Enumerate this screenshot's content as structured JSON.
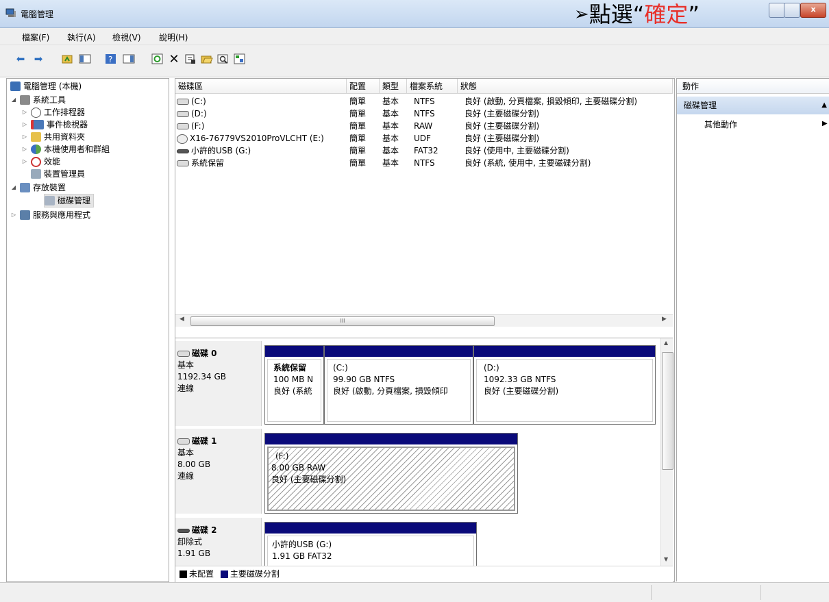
{
  "window": {
    "title": "電腦管理"
  },
  "annotation": {
    "arrow": "➢",
    "prefix": "點選“",
    "highlight": "確定",
    "suffix": "”"
  },
  "menu": [
    "檔案(F)",
    "執行(A)",
    "檢視(V)",
    "說明(H)"
  ],
  "tree": {
    "root": "電腦管理 (本機)",
    "system_tools": "系統工具",
    "task_scheduler": "工作排程器",
    "event_viewer": "事件檢視器",
    "shared_folders": "共用資料夾",
    "local_users": "本機使用者和群組",
    "performance": "效能",
    "device_manager": "裝置管理員",
    "storage": "存放裝置",
    "disk_management": "磁碟管理",
    "services": "服務與應用程式"
  },
  "columns": [
    "磁碟區",
    "配置",
    "類型",
    "檔案系統",
    "狀態"
  ],
  "volumes": [
    {
      "name": "(C:)",
      "layout": "簡單",
      "type": "基本",
      "fs": "NTFS",
      "status": "良好 (啟動, 分頁檔案, 損毀傾印, 主要磁碟分割)"
    },
    {
      "name": "(D:)",
      "layout": "簡單",
      "type": "基本",
      "fs": "NTFS",
      "status": "良好 (主要磁碟分割)"
    },
    {
      "name": "(F:)",
      "layout": "簡單",
      "type": "基本",
      "fs": "RAW",
      "status": "良好 (主要磁碟分割)"
    },
    {
      "name": "X16-76779VS2010ProVLCHT (E:)",
      "layout": "簡單",
      "type": "基本",
      "fs": "UDF",
      "status": "良好 (主要磁碟分割)"
    },
    {
      "name": "小許的USB (G:)",
      "layout": "簡單",
      "type": "基本",
      "fs": "FAT32",
      "status": "良好 (使用中, 主要磁碟分割)"
    },
    {
      "name": "系統保留",
      "layout": "簡單",
      "type": "基本",
      "fs": "NTFS",
      "status": "良好 (系統, 使用中, 主要磁碟分割)"
    }
  ],
  "hscroll_glyph": "III",
  "disks": [
    {
      "label": "磁碟 0",
      "kind": "基本",
      "size": "1192.34 GB",
      "state": "連線",
      "partitions": [
        {
          "line1": "系統保留",
          "line2": "100 MB N",
          "line3": "良好 (系統"
        },
        {
          "line1": "(C:)",
          "line2": "99.90 GB NTFS",
          "line3": "良好 (啟動, 分頁檔案, 損毀傾印"
        },
        {
          "line1": "(D:)",
          "line2": "1092.33 GB NTFS",
          "line3": "良好 (主要磁碟分割)"
        }
      ]
    },
    {
      "label": "磁碟 1",
      "kind": "基本",
      "size": "8.00 GB",
      "state": "連線",
      "partitions": [
        {
          "line1": "(F:)",
          "line2": "8.00 GB RAW",
          "line3": "良好 (主要磁碟分割)"
        }
      ]
    },
    {
      "label": "磁碟 2",
      "kind": "卸除式",
      "size": "1.91 GB",
      "state": "",
      "partitions": [
        {
          "line1": "小許的USB  (G:)",
          "line2": "1.91 GB FAT32",
          "line3": ""
        }
      ]
    }
  ],
  "legend": [
    {
      "label": "未配置",
      "color": "#000000"
    },
    {
      "label": "主要磁碟分割",
      "color": "#0a0a7a"
    }
  ],
  "actions": {
    "header": "動作",
    "section": "磁碟管理",
    "more": "其他動作"
  }
}
